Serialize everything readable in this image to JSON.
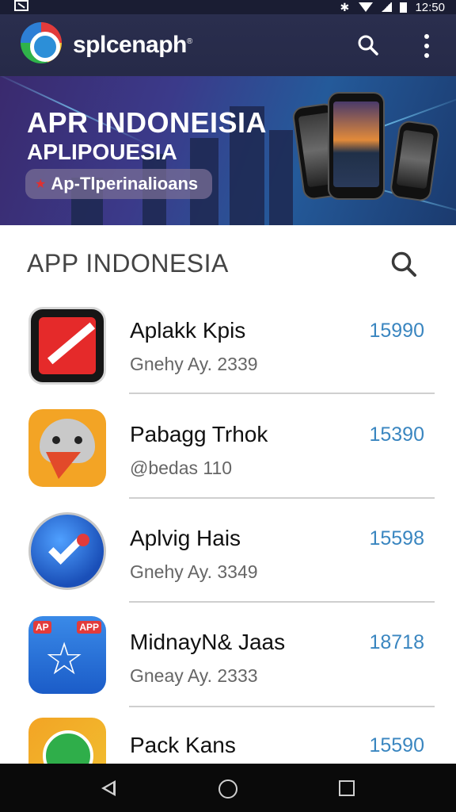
{
  "status_bar": {
    "time": "12:50",
    "icons": [
      "notification-icon",
      "bluetooth-icon",
      "wifi-icon",
      "signal-icon",
      "battery-icon"
    ]
  },
  "app_bar": {
    "app_name": "splcenaph",
    "trademark": "®",
    "icons": [
      "app-logo-icon",
      "search-icon",
      "more-vert-icon"
    ]
  },
  "banner": {
    "title": "APR INDONEISIA",
    "subtitle": "APLIPOUESIA",
    "pill_label": "Ap-Tlperinalioans",
    "pill_icon": "star-icon"
  },
  "section": {
    "title": "APP INDONESIA",
    "icon": "search-icon"
  },
  "apps": [
    {
      "name": "Aplakk Kpis",
      "subtitle": "Gnehy Ay. 2339",
      "count": "15990",
      "icon": "red-plane-app-icon"
    },
    {
      "name": "Pabagg Trhok",
      "subtitle": "@bedas 110",
      "count": "15390",
      "icon": "bird-app-icon"
    },
    {
      "name": "Aplvig Hais",
      "subtitle": "Gnehy Ay. 3349",
      "count": "15598",
      "icon": "check-app-icon"
    },
    {
      "name": "MidnayN& Jaas",
      "subtitle": "Gneay Ay. 2333",
      "count": "18718",
      "icon": "star-app-icon"
    },
    {
      "name": "Pack Kans",
      "subtitle": "",
      "count": "15590",
      "icon": "green-arrow-app-icon"
    }
  ],
  "colors": {
    "app_bar": "#2a2e4e",
    "count_text": "#3a86c0",
    "nav_bar": "#0a0a0a"
  },
  "nav_bar": {
    "icons": [
      "back-icon",
      "home-icon",
      "recents-icon"
    ]
  }
}
